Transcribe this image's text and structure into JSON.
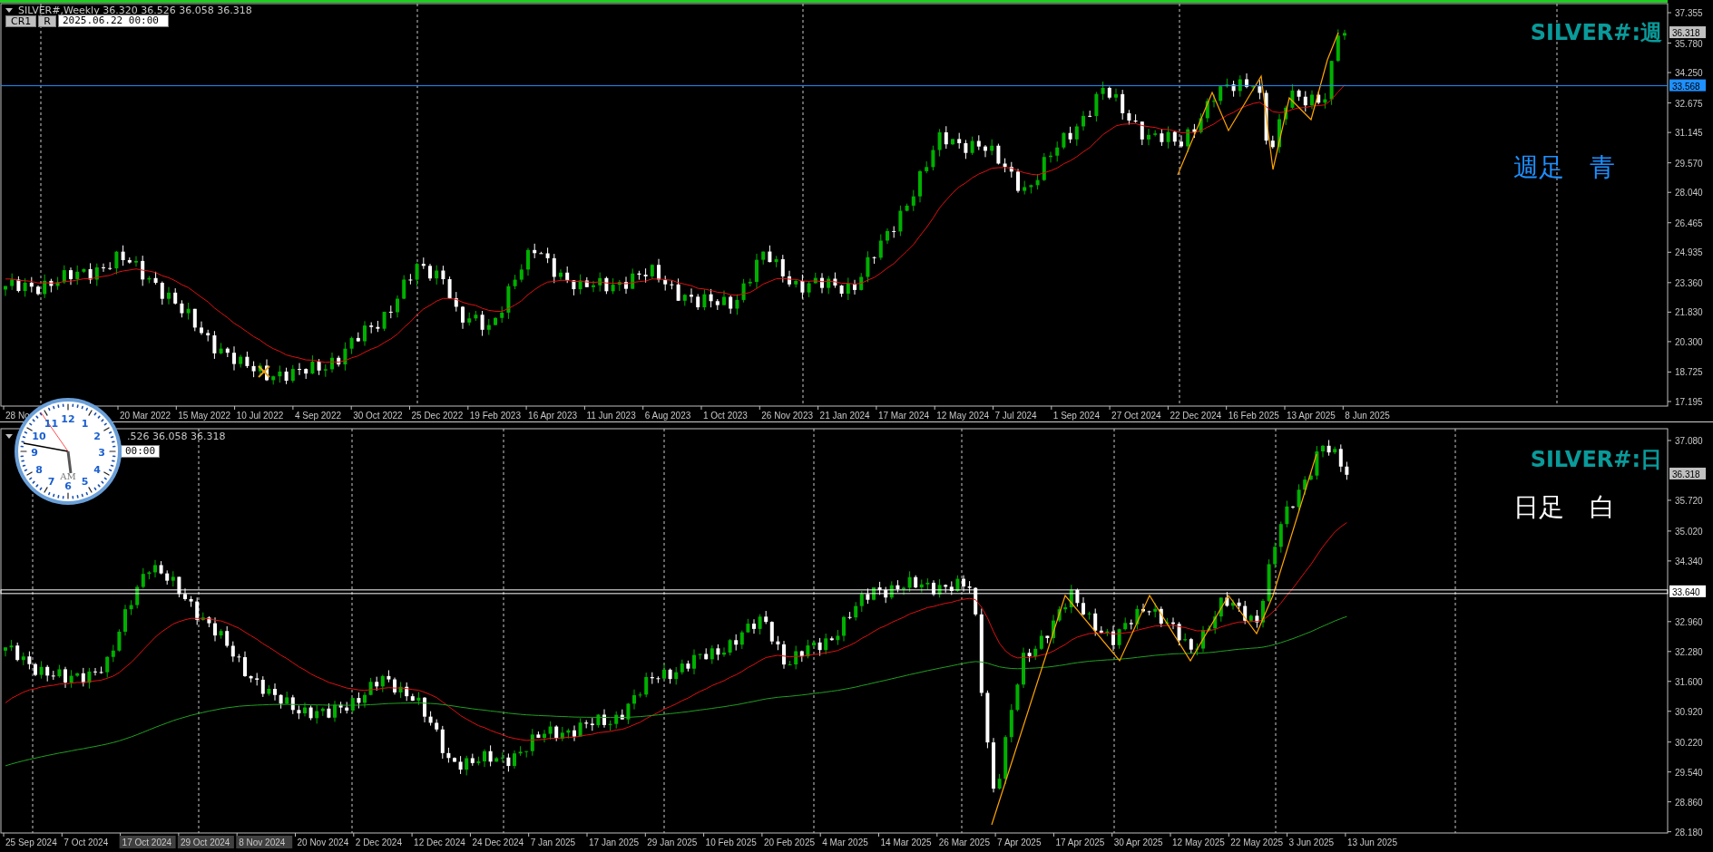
{
  "panes": [
    {
      "kind": "weekly",
      "header": "SILVER#,Weekly  36.320 36.526 36.058 36.318",
      "buttons": [
        {
          "label": "CR1"
        },
        {
          "label": "R"
        }
      ],
      "date_field": "2025.06.22 00:00",
      "symbol": "SILVER#:週",
      "note": {
        "text": "週足　青",
        "color": "#1e90ff"
      },
      "price_ticks": [
        "37.355",
        "35.780",
        "34.250",
        "32.675",
        "31.145",
        "29.570",
        "28.040",
        "26.465",
        "24.935",
        "23.360",
        "21.830",
        "20.300",
        "18.725",
        "17.195"
      ],
      "current_price": "36.318",
      "line": {
        "price": "33.568",
        "kind": "blue"
      },
      "dates": [
        {
          "text": "28 No",
          "shaded": false
        },
        {
          "text": "20 Mar 2022",
          "shaded": false
        },
        {
          "text": "15 May 2022",
          "shaded": false
        },
        {
          "text": "10 Jul 2022",
          "shaded": false
        },
        {
          "text": "4 Sep 2022",
          "shaded": false
        },
        {
          "text": "30 Oct 2022",
          "shaded": false
        },
        {
          "text": "25 Dec 2022",
          "shaded": false
        },
        {
          "text": "19 Feb 2023",
          "shaded": false
        },
        {
          "text": "16 Apr 2023",
          "shaded": false
        },
        {
          "text": "11 Jun 2023",
          "shaded": false
        },
        {
          "text": "6 Aug 2023",
          "shaded": false
        },
        {
          "text": "1 Oct 2023",
          "shaded": false
        },
        {
          "text": "26 Nov 2023",
          "shaded": false
        },
        {
          "text": "21 Jan 2024",
          "shaded": false
        },
        {
          "text": "17 Mar 2024",
          "shaded": false
        },
        {
          "text": "12 May 2024",
          "shaded": false
        },
        {
          "text": "7 Jul 2024",
          "shaded": false
        },
        {
          "text": "1 Sep 2024",
          "shaded": false
        },
        {
          "text": "27 Oct 2024",
          "shaded": false
        },
        {
          "text": "22 Dec 2024",
          "shaded": false
        },
        {
          "text": "16 Feb 2025",
          "shaded": false
        },
        {
          "text": "13 Apr 2025",
          "shaded": false
        },
        {
          "text": "8 Jun 2025",
          "shaded": false
        }
      ]
    },
    {
      "kind": "daily",
      "header": ".526 36.058 36.318",
      "date_field": "00:00",
      "symbol": "SILVER#:日",
      "note": {
        "text": "日足　白",
        "color": "#ffffff"
      },
      "price_ticks": [
        "37.080",
        "35.720",
        "35.020",
        "34.340",
        "32.960",
        "32.280",
        "31.600",
        "30.920",
        "30.220",
        "29.540",
        "28.860",
        "28.180"
      ],
      "current_price": "36.318",
      "line": {
        "price": "33.640",
        "kind": "white"
      },
      "dates": [
        {
          "text": "25 Sep 2024",
          "shaded": false
        },
        {
          "text": "7 Oct 2024",
          "shaded": false
        },
        {
          "text": "17 Oct 2024",
          "shaded": true
        },
        {
          "text": "29 Oct 2024",
          "shaded": true
        },
        {
          "text": "8 Nov 2024",
          "shaded": true
        },
        {
          "text": "20 Nov 2024",
          "shaded": false
        },
        {
          "text": "2 Dec 2024",
          "shaded": false
        },
        {
          "text": "12 Dec 2024",
          "shaded": false
        },
        {
          "text": "24 Dec 2024",
          "shaded": false
        },
        {
          "text": "7 Jan 2025",
          "shaded": false
        },
        {
          "text": "17 Jan 2025",
          "shaded": false
        },
        {
          "text": "29 Jan 2025",
          "shaded": false
        },
        {
          "text": "10 Feb 2025",
          "shaded": false
        },
        {
          "text": "20 Feb 2025",
          "shaded": false
        },
        {
          "text": "4 Mar 2025",
          "shaded": false
        },
        {
          "text": "14 Mar 2025",
          "shaded": false
        },
        {
          "text": "26 Mar 2025",
          "shaded": false
        },
        {
          "text": "7 Apr 2025",
          "shaded": false
        },
        {
          "text": "17 Apr 2025",
          "shaded": false
        },
        {
          "text": "30 Apr 2025",
          "shaded": false
        },
        {
          "text": "12 May 2025",
          "shaded": false
        },
        {
          "text": "22 May 2025",
          "shaded": false
        },
        {
          "text": "3 Jun 2025",
          "shaded": false
        },
        {
          "text": "13 Jun 2025",
          "shaded": false
        }
      ]
    }
  ],
  "clock": {
    "numerals": [
      "11",
      "12",
      "1",
      "10",
      "2",
      "9",
      "3",
      "8",
      "4",
      "7",
      "5",
      "6"
    ],
    "meridiem": "AM"
  }
}
